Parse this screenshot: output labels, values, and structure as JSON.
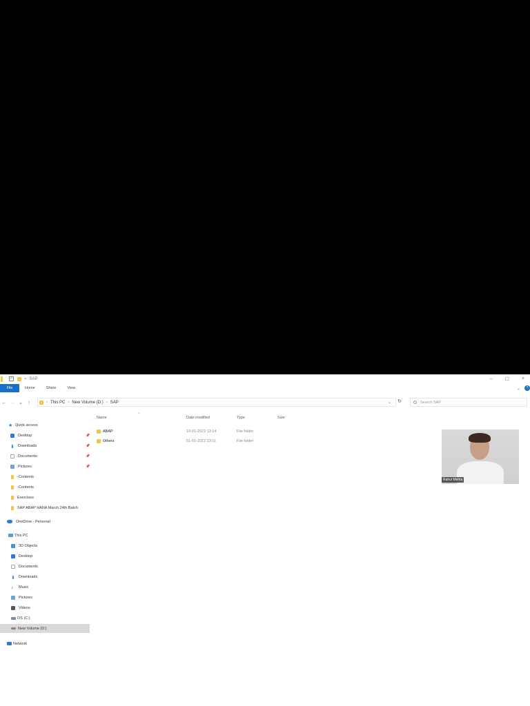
{
  "window": {
    "title": "SAP",
    "controls": {
      "minimize": "–",
      "maximize": "☐",
      "close": "×"
    }
  },
  "ribbon": {
    "tabs": [
      "File",
      "Home",
      "Share",
      "View"
    ],
    "help": "?"
  },
  "address": {
    "path": [
      "This PC",
      "New Volume (D:)",
      "SAP"
    ],
    "search_placeholder": "Search SAP"
  },
  "sidebar": {
    "quick_access": "Quick access",
    "quick_items": [
      {
        "label": "Desktop",
        "pinned": true
      },
      {
        "label": "Downloads",
        "pinned": true
      },
      {
        "label": "Documents",
        "pinned": true
      },
      {
        "label": "Pictures",
        "pinned": true
      },
      {
        "label": "-Contents",
        "pinned": false
      },
      {
        "label": "-Contents",
        "pinned": false
      },
      {
        "label": "Exercises",
        "pinned": false
      },
      {
        "label": "SAP ABAP HANA March 24th Batch",
        "pinned": false
      }
    ],
    "onedrive": "OneDrive - Personal",
    "this_pc": "This PC",
    "pc_items": [
      "3D Objects",
      "Desktop",
      "Documents",
      "Downloads",
      "Music",
      "Pictures",
      "Videos",
      "OS (C:)",
      "New Volume (D:)"
    ],
    "network": "Network",
    "selected": "New Volume (D:)"
  },
  "columns": {
    "name": "Name",
    "date": "Date modified",
    "type": "Type",
    "size": "Size"
  },
  "files": [
    {
      "name": "ABAP",
      "date": "19-01-2022 13:14",
      "type": "File folder"
    },
    {
      "name": "Others",
      "date": "01-01-2022 23:11",
      "type": "File folder"
    }
  ],
  "webcam": {
    "name": "Rahul Mehta"
  }
}
